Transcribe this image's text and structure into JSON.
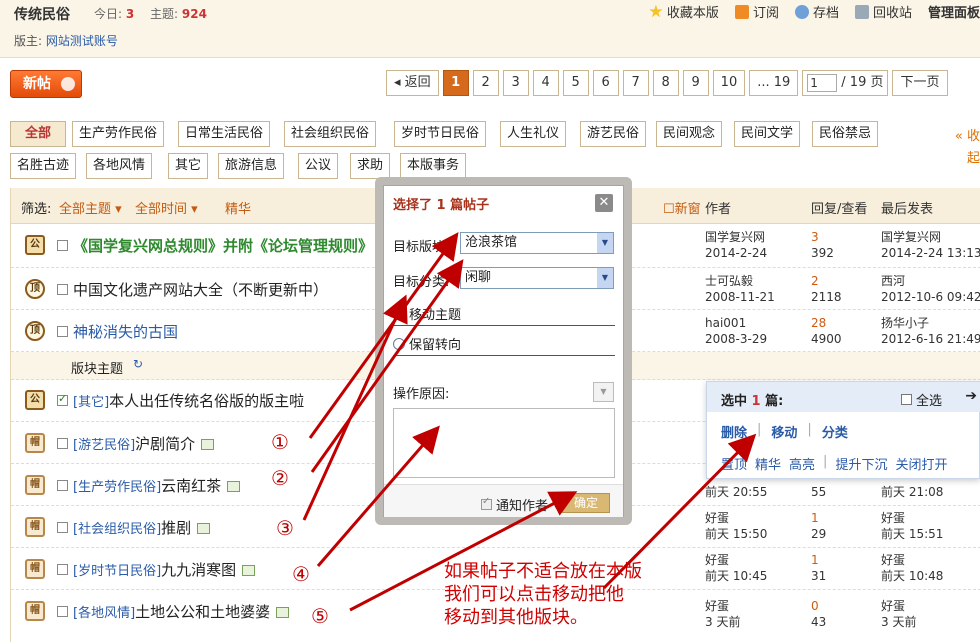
{
  "header": {
    "title": "传统民俗",
    "today_label": "今日:",
    "today_value": "3",
    "topics_label": "主题:",
    "topics_value": "924",
    "moderator_label": "版主:",
    "moderator_name": "网站测试账号",
    "tools": [
      "收藏本版",
      "订阅",
      "存档",
      "回收站",
      "管理面板"
    ]
  },
  "toolbar": {
    "new_post": "新帖",
    "back": "◂ 返回",
    "pages": [
      "1",
      "2",
      "3",
      "4",
      "5",
      "6",
      "7",
      "8",
      "9",
      "10",
      "... 19"
    ],
    "current_page": "1",
    "page_input": "1",
    "page_total": "/ 19 页",
    "next": "下一页"
  },
  "categories_row1": [
    "全部",
    "生产劳作民俗",
    "日常生活民俗",
    "社会组织民俗",
    "岁时节日民俗",
    "人生礼仪",
    "游艺民俗",
    "民间观念",
    "民间文学",
    "民俗禁忌"
  ],
  "categories_row2": [
    "名胜古迹",
    "各地风情",
    "其它",
    "旅游信息",
    "公议",
    "求助",
    "本版事务"
  ],
  "side_hint": [
    "« 收",
    "起"
  ],
  "filter": {
    "label": "筛选:",
    "all_topics": "全部主题",
    "all_time": "全部时间",
    "digest": "精华",
    "new_window": "新窗",
    "col_author": "作者",
    "col_reply": "回复/查看",
    "col_last": "最后发表"
  },
  "section_label": "版块主题",
  "rows": [
    {
      "badge": "公",
      "subject": "《国学复兴网总规则》并附《论坛管理规则》",
      "author": "国学复兴网",
      "author_date": "2014-2-24",
      "replies": "3",
      "views": "392",
      "last_user": "国学复兴网",
      "last_date": "2014-2-24 13:13"
    },
    {
      "badge": "顶",
      "subject": "中国文化遗产网站大全（不断更新中）",
      "author": "士可弘毅",
      "author_date": "2008-11-21",
      "replies": "2",
      "views": "2118",
      "last_user": "西河",
      "last_date": "2012-10-6 09:42"
    },
    {
      "badge": "顶",
      "subject": "神秘消失的古国",
      "author": "hai001",
      "author_date": "2008-3-29",
      "replies": "28",
      "views": "4900",
      "last_user": "扬华小子",
      "last_date": "2012-6-16 21:49"
    },
    {
      "badge": "公",
      "tag": "[其它]",
      "subject": "本人出任传统名俗版的版主啦"
    },
    {
      "badge": "帽",
      "tag": "[游艺民俗]",
      "subject": "沪剧简介",
      "num": "①"
    },
    {
      "badge": "帽",
      "tag": "[生产劳作民俗]",
      "subject": "云南红茶",
      "num": "②",
      "author_date": "前天 20:55",
      "views": "55",
      "last_date": "前天 21:08"
    },
    {
      "badge": "帽",
      "tag": "[社会组织民俗]",
      "subject": "推剧",
      "num": "③",
      "author": "好蛋",
      "author_date": "前天 15:50",
      "replies": "1",
      "views": "29",
      "last_user": "好蛋",
      "last_date": "前天 15:51"
    },
    {
      "badge": "帽",
      "tag": "[岁时节日民俗]",
      "subject": "九九消寒图",
      "num": "④",
      "author": "好蛋",
      "author_date": "前天 10:45",
      "replies": "1",
      "views": "31",
      "last_user": "好蛋",
      "last_date": "前天 10:48"
    },
    {
      "badge": "帽",
      "tag": "[各地风情]",
      "subject": "土地公公和土地婆婆",
      "num": "⑤",
      "author": "好蛋",
      "author_date": "3 天前",
      "replies": "0",
      "views": "43",
      "last_user": "好蛋",
      "last_date": "3 天前"
    }
  ],
  "modal": {
    "title": "选择了 1 篇帖子",
    "target_forum_label": "目标版块:",
    "target_forum_value": "沧浪茶馆",
    "target_cat_label": "目标分类:",
    "target_cat_value": "闲聊",
    "radio_move": "移动主题",
    "radio_keep": "保留转向",
    "reason_label": "操作原因:",
    "notify": "通知作者",
    "ok": "确定"
  },
  "selpanel": {
    "prefix": "选中",
    "count": "1",
    "suffix": "篇:",
    "select_all": "全选",
    "actions": [
      "删除",
      "移动",
      "分类"
    ],
    "actions2": [
      "置顶",
      "精华",
      "高亮",
      "提升下沉",
      "关闭打开"
    ]
  },
  "note": [
    "如果帖子不适合放在本版",
    "我们可以点击移动把他",
    "移动到其他版块。"
  ],
  "colors": {
    "accent": "#d56a1c",
    "annotation": "#c00000",
    "link": "#2a5ba8"
  }
}
